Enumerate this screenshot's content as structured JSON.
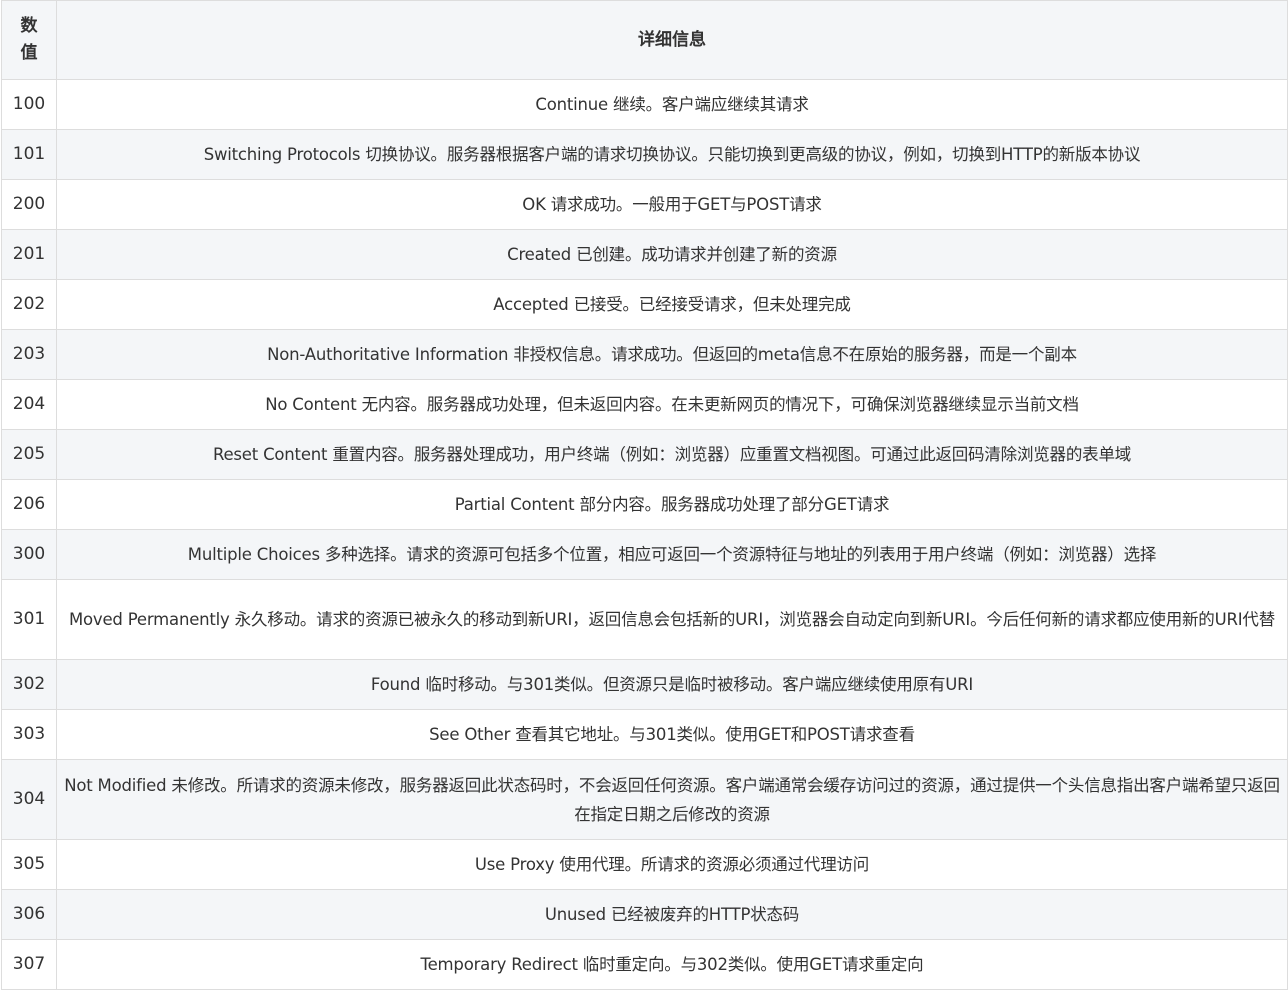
{
  "header": {
    "code_line1": "数",
    "code_line2": "值",
    "desc": "详细信息"
  },
  "rows": [
    {
      "code": "100",
      "desc": "Continue 继续。客户端应继续其请求"
    },
    {
      "code": "101",
      "desc": "Switching Protocols 切换协议。服务器根据客户端的请求切换协议。只能切换到更高级的协议，例如，切换到HTTP的新版本协议"
    },
    {
      "code": "200",
      "desc": "OK 请求成功。一般用于GET与POST请求"
    },
    {
      "code": "201",
      "desc": "Created 已创建。成功请求并创建了新的资源"
    },
    {
      "code": "202",
      "desc": "Accepted 已接受。已经接受请求，但未处理完成"
    },
    {
      "code": "203",
      "desc": "Non-Authoritative Information 非授权信息。请求成功。但返回的meta信息不在原始的服务器，而是一个副本"
    },
    {
      "code": "204",
      "desc": "No Content 无内容。服务器成功处理，但未返回内容。在未更新网页的情况下，可确保浏览器继续显示当前文档"
    },
    {
      "code": "205",
      "desc": "Reset Content 重置内容。服务器处理成功，用户终端（例如：浏览器）应重置文档视图。可通过此返回码清除浏览器的表单域"
    },
    {
      "code": "206",
      "desc": "Partial Content 部分内容。服务器成功处理了部分GET请求"
    },
    {
      "code": "300",
      "desc": "Multiple Choices 多种选择。请求的资源可包括多个位置，相应可返回一个资源特征与地址的列表用于用户终端（例如：浏览器）选择"
    },
    {
      "code": "301",
      "desc": "Moved Permanently 永久移动。请求的资源已被永久的移动到新URI，返回信息会包括新的URI，浏览器会自动定向到新URI。今后任何新的请求都应使用新的URI代替"
    },
    {
      "code": "302",
      "desc": "Found 临时移动。与301类似。但资源只是临时被移动。客户端应继续使用原有URI"
    },
    {
      "code": "303",
      "desc": "See Other 查看其它地址。与301类似。使用GET和POST请求查看"
    },
    {
      "code": "304",
      "desc": "Not Modified 未修改。所请求的资源未修改，服务器返回此状态码时，不会返回任何资源。客户端通常会缓存访问过的资源，通过提供一个头信息指出客户端希望只返回在指定日期之后修改的资源"
    },
    {
      "code": "305",
      "desc": "Use Proxy 使用代理。所请求的资源必须通过代理访问"
    },
    {
      "code": "306",
      "desc": "Unused 已经被废弃的HTTP状态码"
    },
    {
      "code": "307",
      "desc": "Temporary Redirect 临时重定向。与302类似。使用GET请求重定向"
    }
  ]
}
